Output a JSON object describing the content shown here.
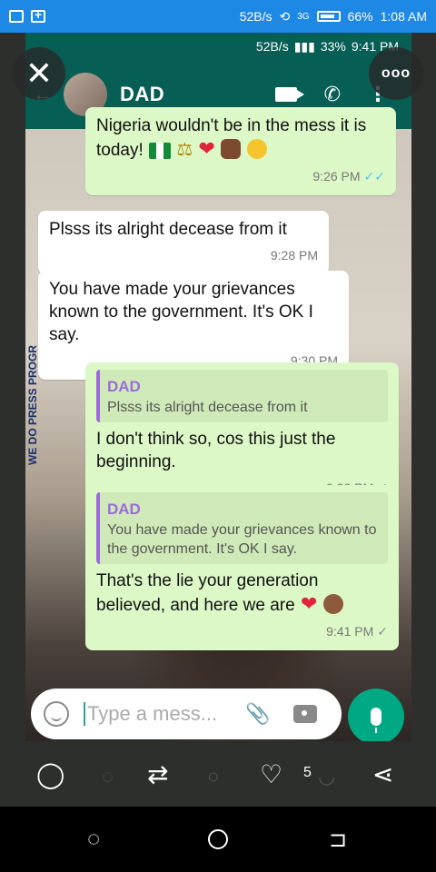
{
  "outer_status": {
    "speed": "52B/s",
    "network": "3G",
    "battery": "66%",
    "time": "1:08 AM"
  },
  "inner_status": {
    "speed": "52B/s",
    "battery": "33%",
    "time": "9:41 PM"
  },
  "chat_header": {
    "contact": "DAD"
  },
  "messages": [
    {
      "type": "out",
      "text": "Nigeria wouldn't be in the mess it is today!",
      "time": "9:26 PM",
      "status": "read"
    },
    {
      "type": "in",
      "text": "Plsss its alright decease from it",
      "time": "9:28 PM"
    },
    {
      "type": "in",
      "text": "You have made your grievances known to the government. It's OK I say.",
      "time": "9:30 PM"
    },
    {
      "type": "out",
      "quote_name": "DAD",
      "quote_text": "Plsss its alright decease from it",
      "text": "I don't think so, cos this just the beginning.",
      "time": "9:39 PM",
      "status": "sent"
    },
    {
      "type": "out",
      "quote_name": "DAD",
      "quote_text": "You have made your grievances known to the government. It's OK I say.",
      "text": "That's the lie your generation believed, and here we are",
      "time": "9:41 PM",
      "status": "sent"
    }
  ],
  "poster": {
    "text": "WE DO PRESS PROGR"
  },
  "composer": {
    "placeholder": "Type a mess..."
  },
  "viewer": {
    "close": "✕",
    "more": "ooo",
    "like_count": "5"
  },
  "icons": {
    "reply": "speech-bubble-icon",
    "retweet": "retweet-icon",
    "like": "heart-icon",
    "share": "share-icon"
  },
  "colors": {
    "header": "#075e54",
    "outgoing": "#dcf8c6",
    "incoming": "#ffffff",
    "accent": "#00a884"
  }
}
